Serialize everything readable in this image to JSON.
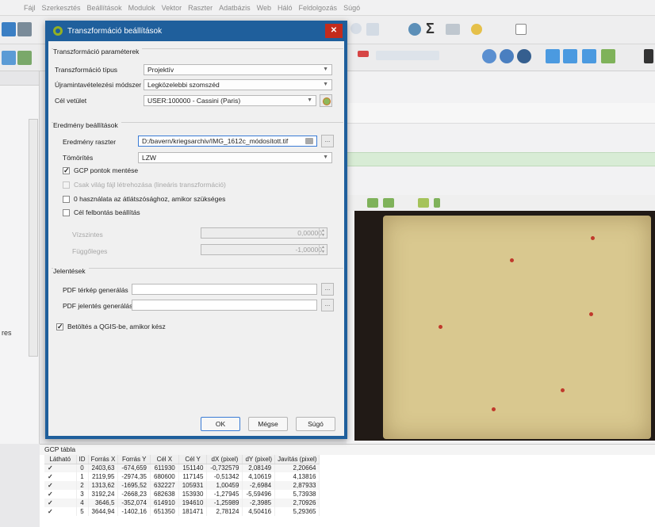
{
  "menubar": [
    "Fájl",
    "Szerkesztés",
    "Beállítások",
    "Modulok",
    "Vektor",
    "Raszter",
    "Adatbázis",
    "Web",
    "Háló",
    "Feldolgozás",
    "Súgó"
  ],
  "left_panel": {
    "partial_label": "res"
  },
  "dialog": {
    "title": "Transzformáció beállítások",
    "close": "✕",
    "params": {
      "title": "Transzformáció paraméterek",
      "type_label": "Transzformáció típus",
      "type_value": "Projektív",
      "resampling_label": "Újramintavételezési módszer",
      "resampling_value": "Legközelebbi szomszéd",
      "target_crs_label": "Cél vetület",
      "target_crs_value": "USER:100000 - Cassini (Paris)"
    },
    "output": {
      "title": "Eredmény beállítások",
      "raster_label": "Eredmény raszter",
      "raster_value": "D:/bavern/kriegsarchiv/IMG_1612c_módosított.tif",
      "compression_label": "Tömörítés",
      "compression_value": "LZW",
      "save_gcp": "GCP pontok mentése",
      "world_file": "Csak világ fájl létrehozása (lineáris transzformáció)",
      "use_zero": "0 használata az átlátszósághoz, amikor szükséges",
      "set_resolution": "Cél felbontás beállítás",
      "horizontal_label": "Vízszintes",
      "horizontal_value": "0,00000",
      "vertical_label": "Függőleges",
      "vertical_value": "-1,00000"
    },
    "reports": {
      "title": "Jelentések",
      "pdf_map_label": "PDF térkép generálás",
      "pdf_report_label": "PDF jelentés generálás",
      "browse": "..."
    },
    "load_in_qgis": "Betöltés a QGIS-be, amikor kész",
    "ok": "OK",
    "cancel": "Mégse",
    "help": "Súgó"
  },
  "gcp": {
    "title": "GCP tábla",
    "headers": [
      "Látható",
      "ID",
      "Forrás X",
      "Forrás Y",
      "Cél X",
      "Cél Y",
      "dX (pixel)",
      "dY (pixel)",
      "Javítás (pixel)"
    ],
    "rows": [
      [
        "✓",
        "0",
        "2403,63",
        "-674,659",
        "611930",
        "151140",
        "-0,732579",
        "2,08149",
        "2,20664"
      ],
      [
        "✓",
        "1",
        "2119,95",
        "-2974,35",
        "680600",
        "117145",
        "-0,51342",
        "4,10619",
        "4,13816"
      ],
      [
        "✓",
        "2",
        "1313,62",
        "-1695,52",
        "632227",
        "105931",
        "1,00459",
        "-2,6984",
        "2,87933"
      ],
      [
        "✓",
        "3",
        "3192,24",
        "-2668,23",
        "682638",
        "153930",
        "-1,27945",
        "-5,59496",
        "5,73938"
      ],
      [
        "✓",
        "4",
        "3646,5",
        "-352,074",
        "614910",
        "194610",
        "-1,25989",
        "-2,3985",
        "2,70926"
      ],
      [
        "✓",
        "5",
        "3644,94",
        "-1402,16",
        "651350",
        "181471",
        "2,78124",
        "4,50416",
        "5,29365"
      ]
    ]
  },
  "colors": {
    "title_bar": "#1f5f9c",
    "close_button": "#c42b1c",
    "gcp_point": "#c0392b"
  }
}
